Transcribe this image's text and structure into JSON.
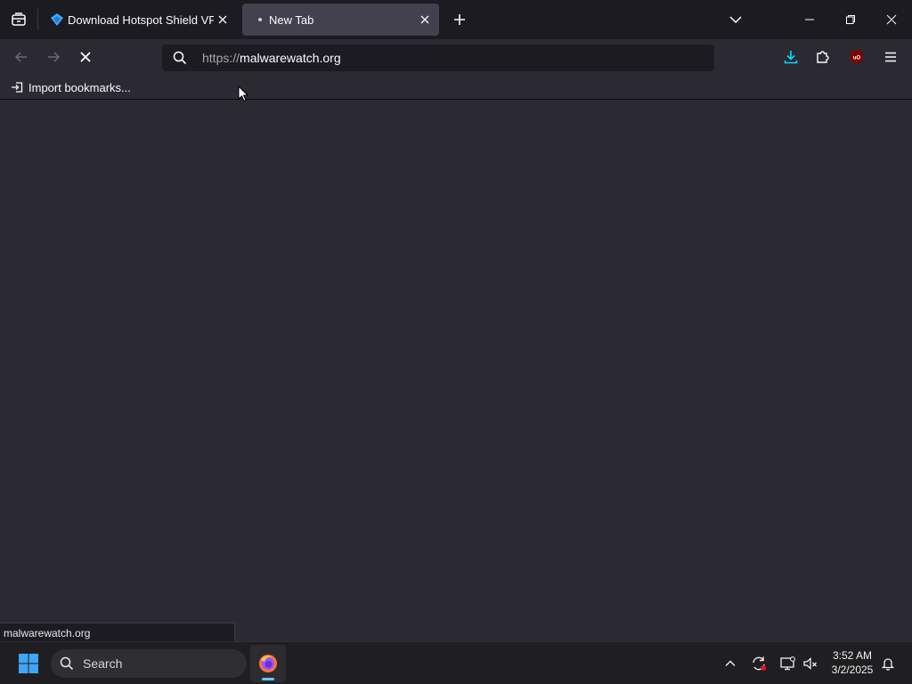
{
  "tabs": [
    {
      "title": "Download Hotspot Shield VPN",
      "active": false
    },
    {
      "title": "New Tab",
      "active": true,
      "loading": true
    }
  ],
  "navbar": {
    "url_scheme": "https://",
    "url_host": "malwarewatch.org"
  },
  "bookmarks_bar": {
    "import_label": "Import bookmarks..."
  },
  "status_panel": {
    "text": "malwarewatch.org"
  },
  "taskbar": {
    "search_label": "Search",
    "clock_time": "3:52 AM",
    "clock_date": "3/2/2025"
  },
  "icons": {
    "tab_list": "tab-list-icon",
    "tab1_favicon": "hotspot-shield-icon",
    "close": "close-icon",
    "new_tab": "plus-icon",
    "list_all_tabs": "chevron-down-icon",
    "back": "back-arrow-icon",
    "forward": "forward-arrow-icon",
    "stop": "stop-icon",
    "search": "search-icon",
    "downloads": "download-icon",
    "extensions": "puzzle-icon",
    "ublock": "ublock-origin-icon",
    "menu": "hamburger-menu-icon",
    "import": "import-icon",
    "start": "windows-start-icon",
    "firefox": "firefox-icon",
    "notification": "bell-icon"
  },
  "colors": {
    "chrome_dark": "#1c1b22",
    "toolbar": "#2b2a33",
    "active_tab": "#42414d",
    "accent": "#00ddff",
    "taskbar": "#1f1f21",
    "ublock_red": "#800000"
  }
}
